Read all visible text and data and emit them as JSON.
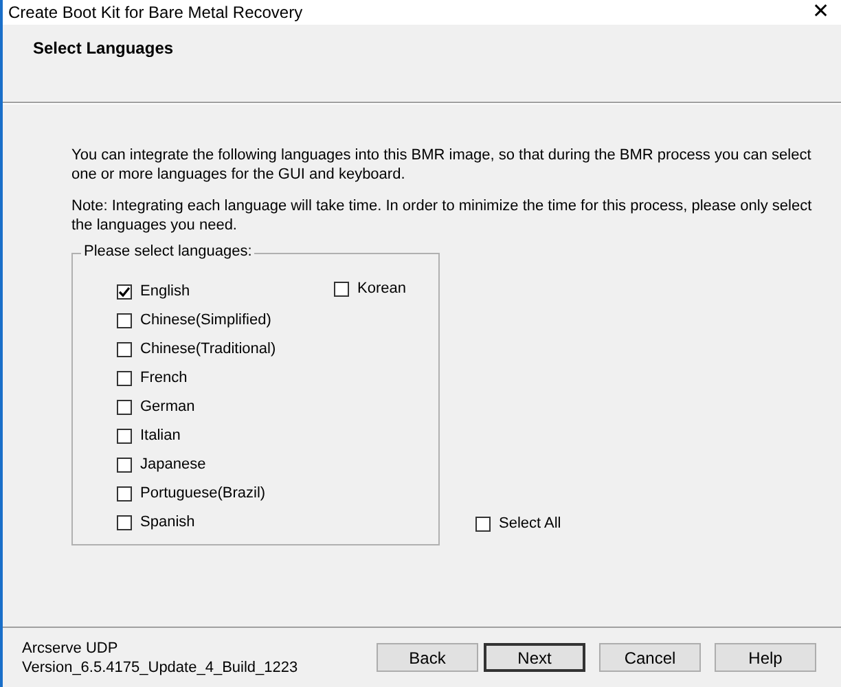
{
  "window": {
    "title": "Create Boot Kit for Bare Metal Recovery",
    "close": "✕"
  },
  "header": {
    "title": "Select Languages"
  },
  "paragraphs": [
    "You can integrate the following languages into this BMR image, so that during the BMR process you can select one or more languages for the GUI and keyboard.",
    "Note: Integrating each language will take time. In order to minimize the time for this process, please only select the languages you need."
  ],
  "group": {
    "legend": "Please select languages:",
    "columns": [
      [
        {
          "label": "English",
          "checked": true
        },
        {
          "label": "Chinese(Simplified)",
          "checked": false
        },
        {
          "label": "Chinese(Traditional)",
          "checked": false
        },
        {
          "label": "French",
          "checked": false
        },
        {
          "label": "German",
          "checked": false
        },
        {
          "label": "Italian",
          "checked": false
        },
        {
          "label": "Japanese",
          "checked": false
        },
        {
          "label": "Portuguese(Brazil)",
          "checked": false
        },
        {
          "label": "Spanish",
          "checked": false
        }
      ],
      [
        {
          "label": "Korean",
          "checked": false
        }
      ]
    ]
  },
  "select_all": {
    "label": "Select All",
    "checked": false
  },
  "footer": {
    "product": "Arcserve UDP",
    "version": "Version_6.5.4175_Update_4_Build_1223"
  },
  "buttons": [
    {
      "label": "Back",
      "default": false
    },
    {
      "label": "Next",
      "default": true
    },
    {
      "label": "Cancel",
      "default": false
    },
    {
      "label": "Help",
      "default": false
    }
  ]
}
